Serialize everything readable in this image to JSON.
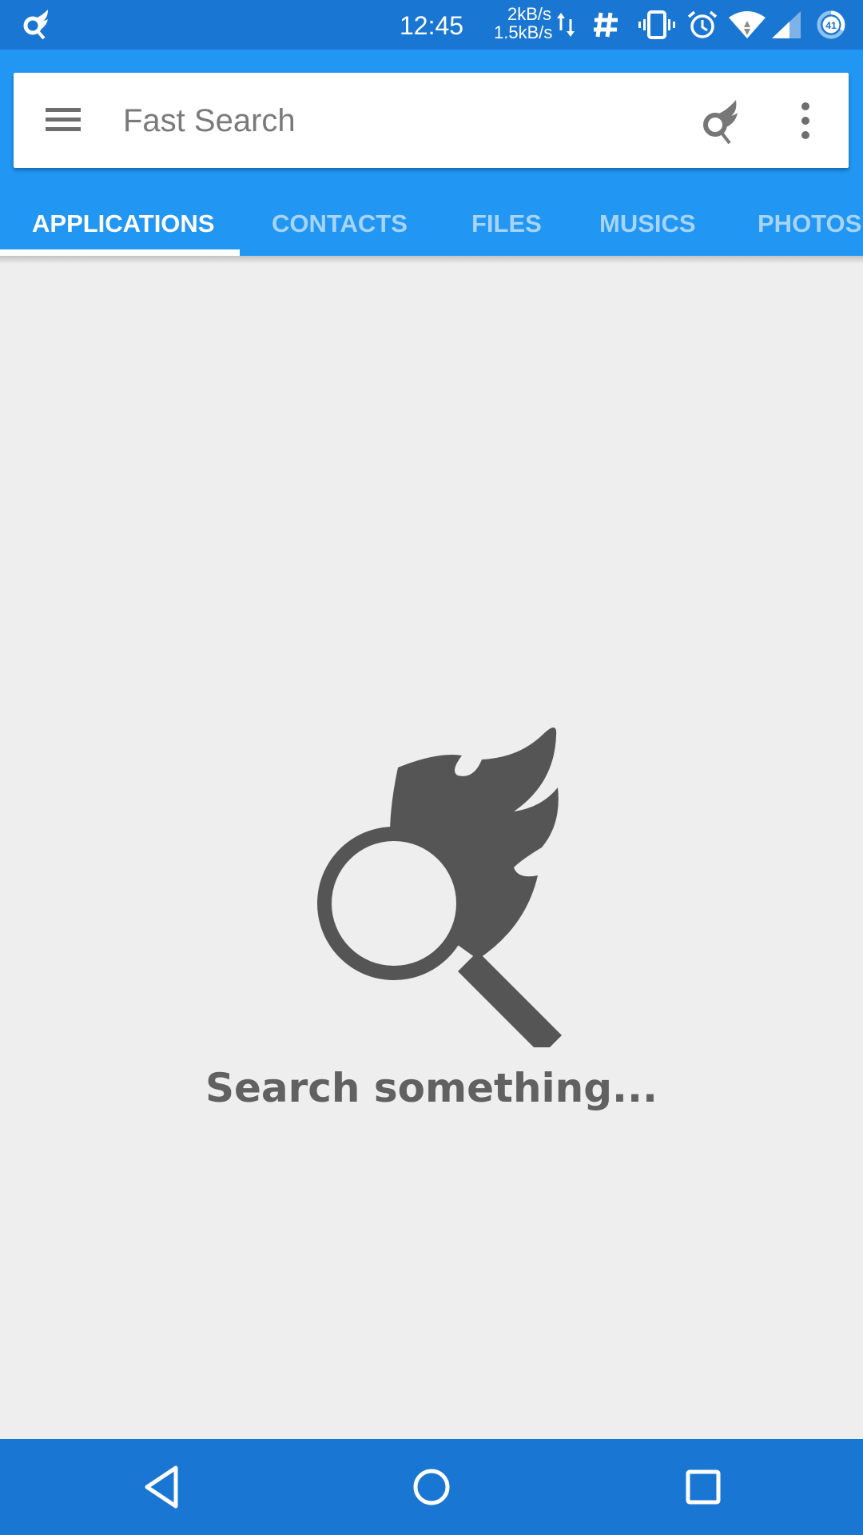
{
  "status_bar": {
    "app_icon": "fast-search-logo-icon",
    "time": "12:45",
    "upload_speed": "2kB/s",
    "download_speed": "1.5kB/s",
    "icons": [
      "data-transfer-icon",
      "hash-icon",
      "vibrate-icon",
      "alarm-icon",
      "wifi-icon",
      "cell-signal-icon",
      "battery-icon"
    ],
    "battery_level": "41"
  },
  "search_bar": {
    "menu_icon": "hamburger-menu-icon",
    "placeholder": "Fast Search",
    "value": "",
    "logo_icon": "fast-search-logo-icon",
    "more_icon": "more-vert-icon"
  },
  "tabs": [
    {
      "label": "APPLICATIONS",
      "active": true
    },
    {
      "label": "CONTACTS",
      "active": false
    },
    {
      "label": "FILES",
      "active": false
    },
    {
      "label": "MUSICS",
      "active": false
    },
    {
      "label": "PHOTOS",
      "active": false
    }
  ],
  "empty_state": {
    "icon": "fast-search-logo-icon",
    "message": "Search something..."
  },
  "nav_bar": {
    "back_icon": "back-icon",
    "home_icon": "home-icon",
    "recents_icon": "recents-icon"
  },
  "colors": {
    "status_bar": "#1976d2",
    "app_bar": "#2196f3",
    "background": "#eeeeee",
    "tab_active": "#ffffff",
    "tab_inactive": "#a6d4fa",
    "empty_icon": "#555555",
    "empty_text": "#616161"
  }
}
